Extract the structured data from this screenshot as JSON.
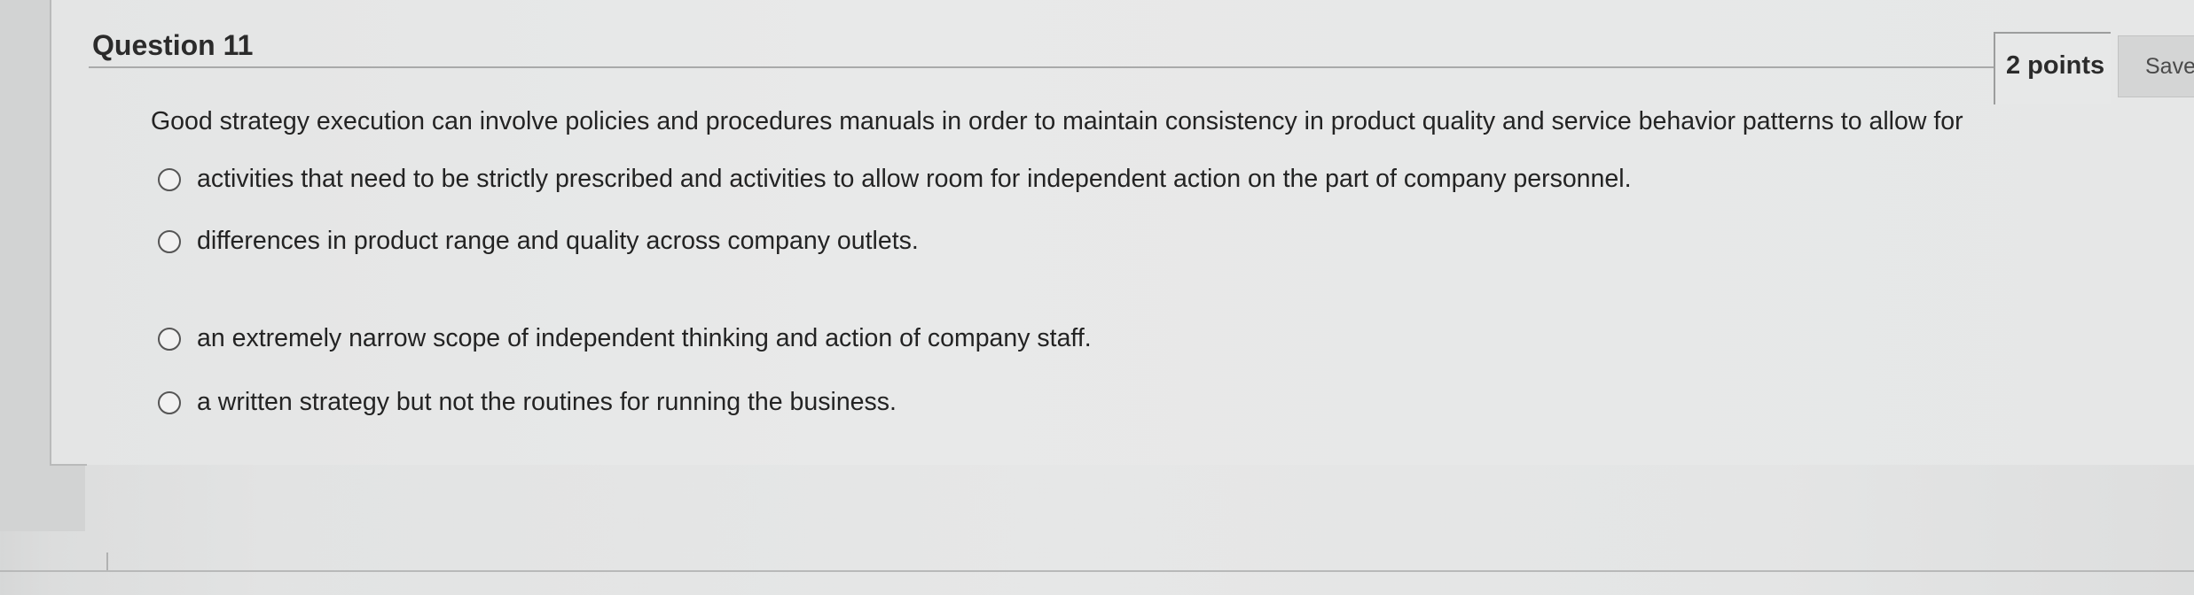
{
  "question": {
    "title": "Question 11",
    "points": "2 points",
    "save_label": "Save",
    "prompt": "Good strategy execution can involve policies and procedures manuals in order to maintain consistency in product quality and service behavior patterns to allow for",
    "options": [
      {
        "label": "activities that need to be strictly prescribed and activities to allow room for independent action on the part of company personnel.",
        "selected": false
      },
      {
        "label": "differences in product range and quality across company outlets.",
        "selected": false
      },
      {
        "label": "an extremely narrow scope of independent thinking and action of company staff.",
        "selected": false
      },
      {
        "label": "a written strategy but not the routines for running the business.",
        "selected": false
      }
    ]
  }
}
